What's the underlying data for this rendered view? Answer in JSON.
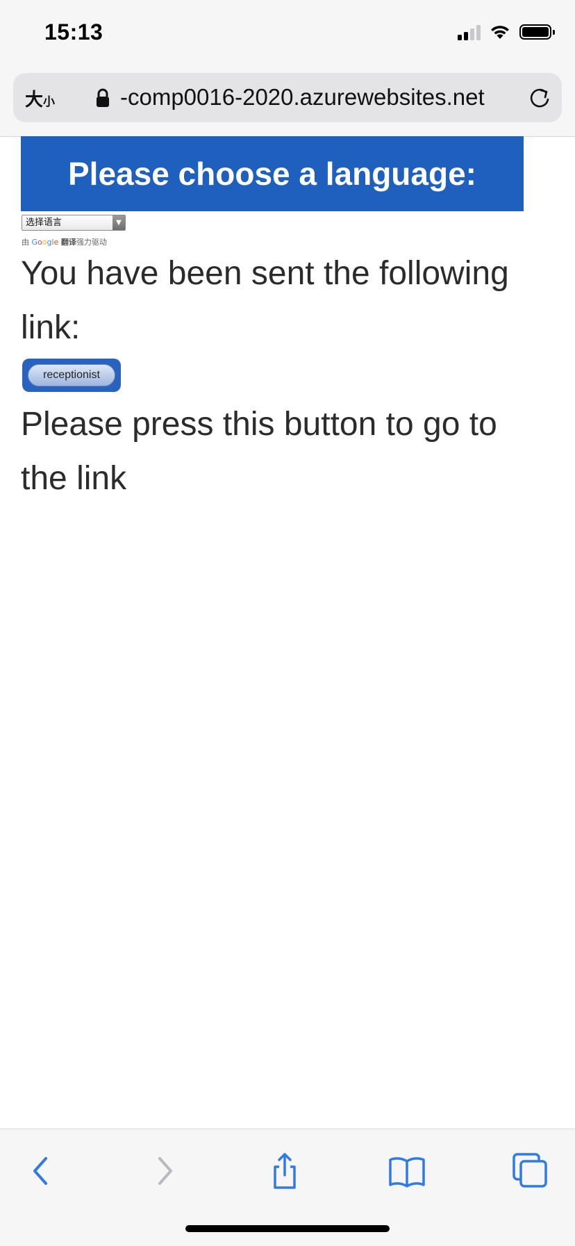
{
  "status_bar": {
    "time": "15:13"
  },
  "address_bar": {
    "text_size_big": "大",
    "text_size_small": "小",
    "url": "-comp0016-2020.azurewebsites.net"
  },
  "page": {
    "banner_title": "Please choose a language:",
    "language_select": {
      "selected": "选择语言"
    },
    "powered_by": {
      "prefix": "由",
      "google": [
        "G",
        "o",
        "o",
        "g",
        "l",
        "e"
      ],
      "translate": "翻译",
      "suffix": "强力驱动"
    },
    "message": "You have been sent the following link:",
    "link_button_label": "receptionist",
    "instruction": "Please press this button to go to the link"
  },
  "colors": {
    "accent": "#1f5fbd",
    "toolbar_icon": "#2f7ae5",
    "toolbar_icon_disabled": "#b9b9be"
  }
}
